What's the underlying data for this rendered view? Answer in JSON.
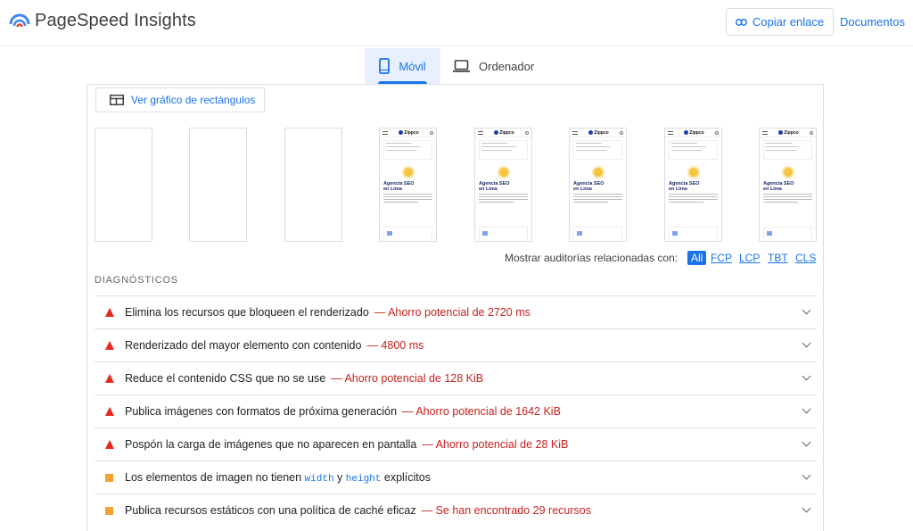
{
  "header": {
    "app_title": "PageSpeed Insights",
    "copy_link_label": "Copiar enlace",
    "docs_label": "Documentos",
    "logo_icon": "pagespeed-logo-icon",
    "colors": {
      "accent": "#1a73e8"
    }
  },
  "tabs": [
    {
      "label": "Móvil",
      "icon": "smartphone-icon",
      "selected": true
    },
    {
      "label": "Ordenador",
      "icon": "laptop-icon",
      "selected": false
    }
  ],
  "treemap_button": {
    "label": "Ver gráfico de rectángulos",
    "icon": "treemap-icon"
  },
  "filmstrip": {
    "brand": "Zippco",
    "heading_line1": "Agencia SEO",
    "heading_line2": "en Lima"
  },
  "filter": {
    "label": "Mostrar auditorías relacionadas con:",
    "chips": [
      "All",
      "FCP",
      "LCP",
      "TBT",
      "CLS"
    ],
    "selected": "All"
  },
  "diagnostics": {
    "title": "DIAGNÓSTICOS",
    "items": [
      {
        "severity": "fail",
        "title": "Elimina los recursos que bloqueen el renderizado",
        "detail": "— Ahorro potencial de 2720 ms"
      },
      {
        "severity": "fail",
        "title": "Renderizado del mayor elemento con contenido",
        "detail": "— 4800 ms"
      },
      {
        "severity": "fail",
        "title": "Reduce el contenido CSS que no se use",
        "detail": "— Ahorro potencial de 128 KiB"
      },
      {
        "severity": "fail",
        "title": "Publica imágenes con formatos de próxima generación",
        "detail": "— Ahorro potencial de 1642 KiB"
      },
      {
        "severity": "fail",
        "title": "Pospón la carga de imágenes que no aparecen en pantalla",
        "detail": "— Ahorro potencial de 28 KiB"
      },
      {
        "severity": "average",
        "title_before": "Los elementos de imagen no tienen",
        "code1": "width",
        "conj": "y",
        "code2": "height",
        "title_after": "explícitos"
      },
      {
        "severity": "average",
        "title": "Publica recursos estáticos con una política de caché eficaz",
        "detail": "— Se han encontrado 29 recursos"
      }
    ]
  }
}
